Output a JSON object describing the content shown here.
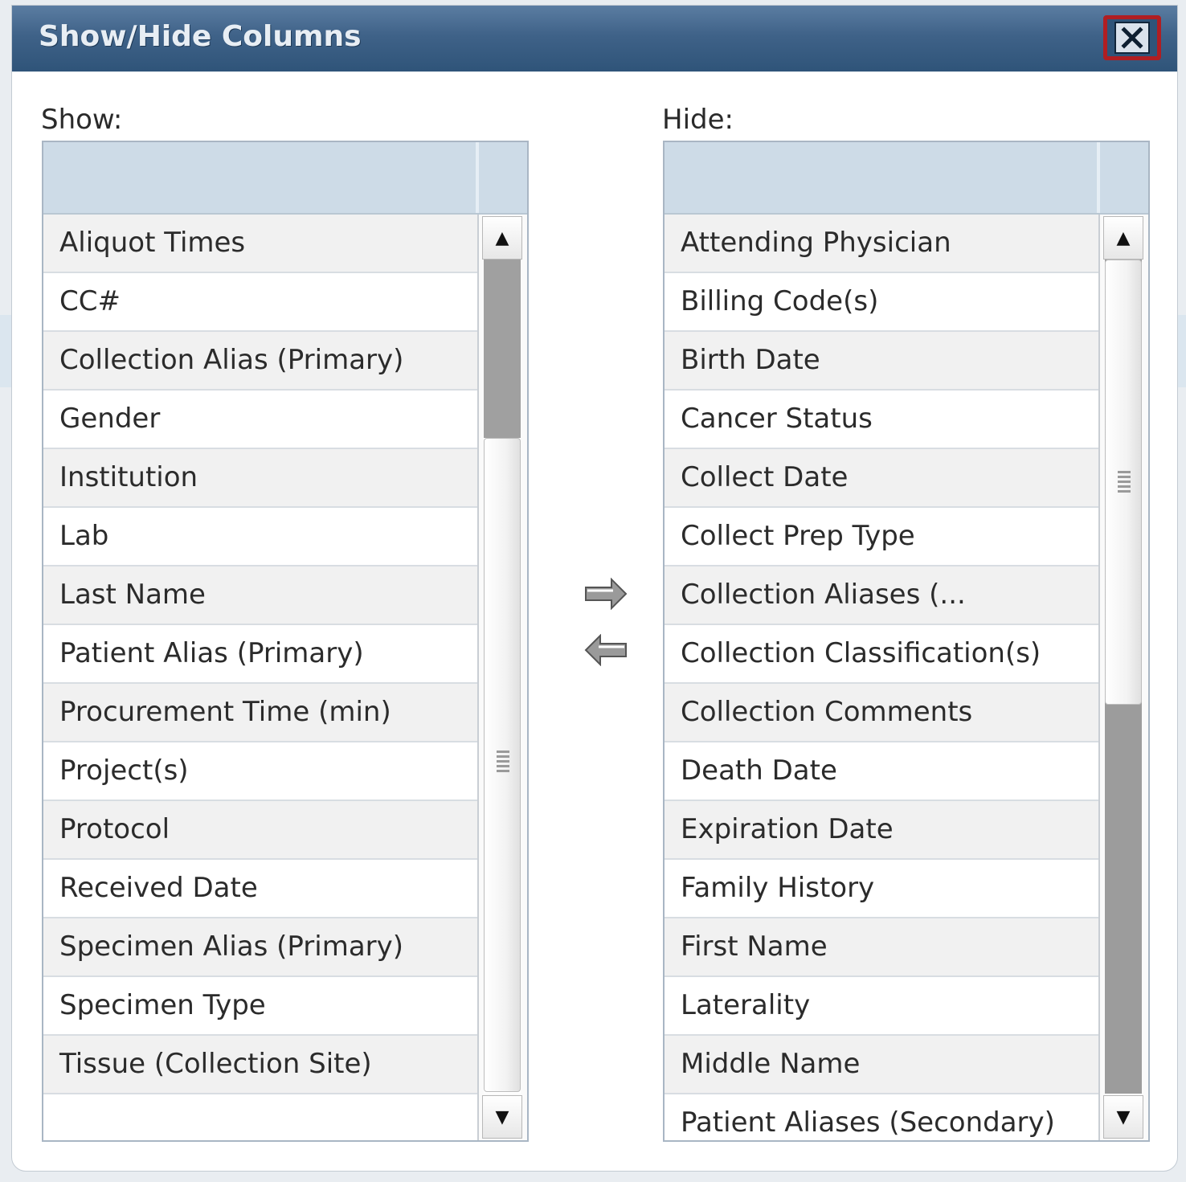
{
  "dialog": {
    "title": "Show/Hide Columns",
    "close_label": "✕"
  },
  "show_panel": {
    "label": "Show:",
    "items": [
      "Aliquot Times",
      "CC#",
      "Collection Alias (Primary)",
      "Gender",
      "Institution",
      "Lab",
      "Last Name",
      "Patient Alias (Primary)",
      "Procurement Time (min)",
      "Project(s)",
      "Protocol",
      "Received Date",
      "Specimen Alias (Primary)",
      "Specimen Type",
      "Tissue (Collection Site)"
    ],
    "scroll_position": 0.0,
    "scroll_up": "▲",
    "scroll_down": "▼"
  },
  "hide_panel": {
    "label": "Hide:",
    "items": [
      "Attending Physician",
      "Billing Code(s)",
      "Birth Date",
      "Cancer Status",
      "Collect Date",
      "Collect Prep Type",
      "Collection Aliases (...",
      "Collection Classification(s)",
      "Collection Comments",
      "Death Date",
      "Expiration Date",
      "Family History",
      "First Name",
      "Laterality",
      "Middle Name",
      "Patient Aliases (Secondary)"
    ],
    "scroll_position": 0.0,
    "scroll_up": "▲",
    "scroll_down": "▼"
  },
  "move_buttons": {
    "to_hide_icon": "arrow-right-icon",
    "to_show_icon": "arrow-left-icon"
  },
  "colors": {
    "titlebar": "#3f6288",
    "close_highlight": "#b01e22",
    "header": "#cddbe7",
    "row_alt": "#f1f1f1"
  }
}
